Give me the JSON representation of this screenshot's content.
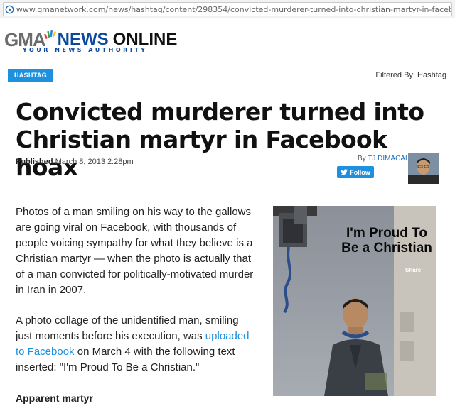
{
  "browser": {
    "url": "www.gmanetwork.com/news/hashtag/content/298354/convicted-murderer-turned-into-christian-martyr-in-facebook-hoax/sto"
  },
  "site": {
    "logo_gma": "GMA",
    "logo_news": "NEWS",
    "logo_online": "ONLINE",
    "tagline": "YOUR NEWS AUTHORITY"
  },
  "section": {
    "tag": "HASHTAG",
    "filtered_by": "Filtered By: Hashtag"
  },
  "article": {
    "headline": "Convicted murderer turned into Christian martyr in Facebook hoax",
    "published_label": "Published",
    "published_date": "March 8, 2013 2:28pm",
    "by_label": "By",
    "author": "TJ DIMACALI",
    "follow_label": "Follow",
    "para1": "Photos of a man smiling on his way to the gallows are going viral on Facebook, with thousands of people voicing sympathy for what they believe is a Christian martyr — when the photo is actually that of a man convicted for politically-motivated murder in Iran in 2007.",
    "para2_before": "A photo collage of the unidentified man, smiling just moments before his execution, was ",
    "para2_link": "uploaded to Facebook",
    "para2_after": " on March 4 with the following text inserted: \"I'm Proud To Be a Christian.\"",
    "subhead": "Apparent martyr"
  },
  "photo": {
    "overlay_text": "I'm Proud To Be a Christian",
    "share_text": "Share"
  },
  "colors": {
    "accent_blue": "#1e90e0",
    "news_blue": "#0b4a9b"
  }
}
